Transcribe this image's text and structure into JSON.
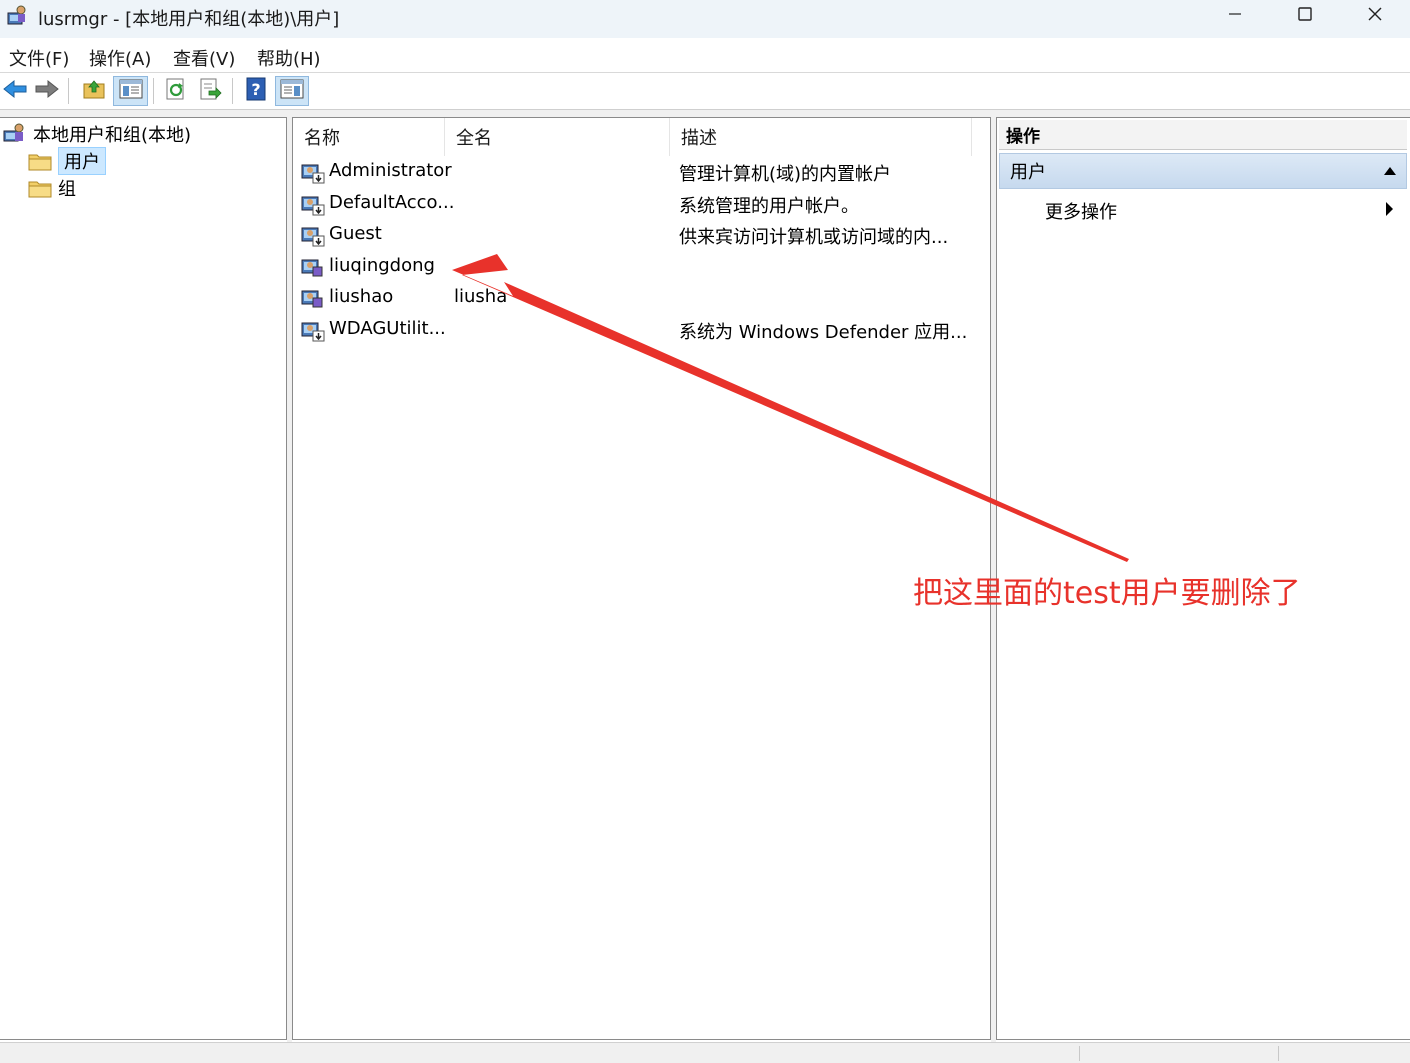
{
  "window": {
    "title": "lusrmgr - [本地用户和组(本地)\\用户]",
    "controls": {
      "minimize": "minimize-icon",
      "maximize": "maximize-icon",
      "close": "close-icon"
    }
  },
  "menu": {
    "items": [
      {
        "label": "文件(F)"
      },
      {
        "label": "操作(A)"
      },
      {
        "label": "查看(V)"
      },
      {
        "label": "帮助(H)"
      }
    ]
  },
  "toolbar": {
    "buttons": [
      "back-arrow-icon",
      "forward-arrow-icon",
      "up-folder-icon",
      "show-hide-tree-icon",
      "refresh-icon",
      "export-list-icon",
      "help-icon",
      "show-hide-action-pane-icon"
    ]
  },
  "tree": {
    "root": "本地用户和组(本地)",
    "children": [
      {
        "label": "用户",
        "selected": true
      },
      {
        "label": "组",
        "selected": false
      }
    ]
  },
  "list": {
    "columns": [
      "名称",
      "全名",
      "描述"
    ],
    "rows": [
      {
        "name": "Administrator",
        "fullname": "",
        "description": "管理计算机(域)的内置帐户"
      },
      {
        "name": "DefaultAcco...",
        "fullname": "",
        "description": "系统管理的用户帐户。"
      },
      {
        "name": "Guest",
        "fullname": "",
        "description": "供来宾访问计算机或访问域的内..."
      },
      {
        "name": "liuqingdong",
        "fullname": "",
        "description": ""
      },
      {
        "name": "liushao",
        "fullname": "liusha",
        "description": ""
      },
      {
        "name": "WDAGUtilit...",
        "fullname": "",
        "description": "系统为 Windows Defender 应用..."
      }
    ]
  },
  "actions": {
    "header": "操作",
    "section": "用户",
    "more": "更多操作"
  },
  "annotation": {
    "text": "把这里面的test用户要删除了",
    "color": "#e8322b"
  }
}
